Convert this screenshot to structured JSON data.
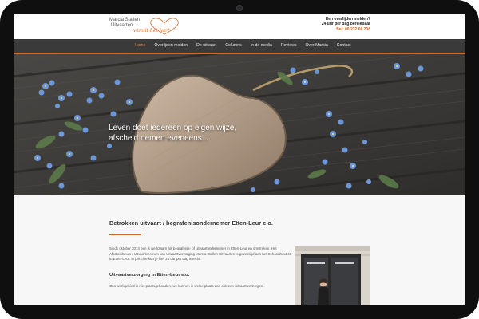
{
  "brand": {
    "line1": "Marcia Stallen",
    "line2": "Uitvaarten",
    "script": "vanuit het hart",
    "accent_color": "#d06a2a"
  },
  "contact": {
    "line1": "Een overlijden melden?",
    "line2": "24 uur per dag bereikbaar",
    "phone": "Bel: 06 232 68 208"
  },
  "nav": {
    "items": [
      "Home",
      "Overlijden melden",
      "De uitvaart",
      "Columns",
      "In de media",
      "Reviews",
      "Over Marcia",
      "Contact"
    ],
    "active": "Home"
  },
  "hero": {
    "line1": "Leven doet iedereen op eigen wijze,",
    "line2": "afscheid nemen eveneens..."
  },
  "main": {
    "title": "Betrokken uitvaart / begrafenisondernemer Etten-Leur e.o.",
    "intro": "Sinds oktober 2014 ben ik werkzaam als begrafenis- of uitvaartondernemer in Etten-Leur en omstreken. Het Afscheidshuis / Uitvaartcentrum van Uitvaartverzorging Marcia Stallen Uitvaarten is gevestigd aan het Schoonhout 48 in Etten-Leur. In principe kun je hier 24 uur per dag terecht.",
    "subheading": "Uitvaartverzorging in Etten-Leur e.o.",
    "para2": "Ons werkgebied is niet plaatsgebonden, we kunnen in welke plaats dan ook een uitvaart verzorgen."
  }
}
